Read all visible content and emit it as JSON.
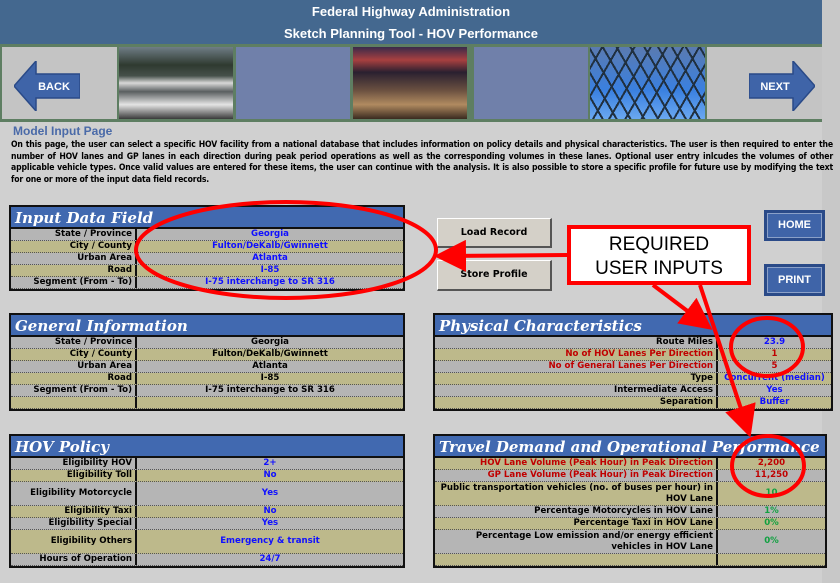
{
  "header": {
    "line1": "Federal Highway Administration",
    "line2": "Sketch Planning Tool - HOV Performance"
  },
  "nav": {
    "back_label": "BACK",
    "next_label": "NEXT",
    "nav_color": "#3f64a8"
  },
  "page": {
    "title": "Model Input Page",
    "intro": "On this page, the user can select a specific HOV facility from a national database that includes information on policy details and physical characteristics. The user is then required to enter the number of HOV lanes and GP lanes in each direction during peak period operations as well as the corresponding volumes in these lanes. Optional user entry inlcudes the volumes of other applicable vehicle types. Once valid values are entered for these items, the user can continue with the analysis. It is also possible to store a specific profile for future use by modifying the text for one or more of the input data field records."
  },
  "buttons": {
    "load": "Load Record",
    "store": "Store Profile",
    "home": "HOME",
    "print": "PRINT"
  },
  "annotation": {
    "callout_line1": "REQUIRED",
    "callout_line2": "USER INPUTS",
    "color": "#ff0000"
  },
  "input_data": {
    "title": "Input Data Field",
    "rows": [
      {
        "label": "State / Province",
        "value": "Georgia"
      },
      {
        "label": "City / County",
        "value": "Fulton/DeKalb/Gwinnett"
      },
      {
        "label": "Urban Area",
        "value": "Atlanta"
      },
      {
        "label": "Road",
        "value": "I-85"
      },
      {
        "label": "Segment (From - To)",
        "value": "I-75 interchange to SR 316"
      }
    ]
  },
  "general_info": {
    "title": "General Information",
    "rows": [
      {
        "label": "State / Province",
        "value": "Georgia"
      },
      {
        "label": "City / County",
        "value": "Fulton/DeKalb/Gwinnett"
      },
      {
        "label": "Urban Area",
        "value": "Atlanta"
      },
      {
        "label": "Road",
        "value": "I-85"
      },
      {
        "label": "Segment (From - To)",
        "value": "I-75 interchange to SR 316"
      },
      {
        "label": "",
        "value": ""
      }
    ]
  },
  "hov_policy": {
    "title": "HOV Policy",
    "rows": [
      {
        "label": "Eligibility HOV",
        "value": "2+"
      },
      {
        "label": "Eligibility Toll",
        "value": "No"
      },
      {
        "label": "Eligibility Motorcycle",
        "value": "Yes"
      },
      {
        "label": "Eligibility Taxi",
        "value": "No"
      },
      {
        "label": "Eligibility Special",
        "value": "Yes"
      },
      {
        "label": "Eligibility Others",
        "value": "Emergency & transit"
      },
      {
        "label": "Hours of Operation",
        "value": "24/7"
      }
    ]
  },
  "physical": {
    "title": "Physical Characteristics",
    "rows": [
      {
        "label": "Route Miles",
        "value": "23.9"
      },
      {
        "label": "No of HOV Lanes Per Direction",
        "value": "1"
      },
      {
        "label": "No of General Lanes Per Direction",
        "value": "5"
      },
      {
        "label": "Type",
        "value": "Concurrent (median)"
      },
      {
        "label": "Intermediate Access",
        "value": "Yes"
      },
      {
        "label": "Separation",
        "value": "Buffer"
      }
    ]
  },
  "travel": {
    "title": "Travel Demand and Operational Performance",
    "rows": [
      {
        "label": "HOV Lane Volume (Peak Hour) in Peak Direction",
        "value": "2,200"
      },
      {
        "label": "GP Lane Volume (Peak Hour) in Peak Direction",
        "value": "11,250"
      },
      {
        "label": "Public transportation vehicles (no. of buses per hour) in HOV Lane",
        "value": "10"
      },
      {
        "label": "Percentage Motorcycles in HOV Lane",
        "value": "1%"
      },
      {
        "label": "Percentage Taxi in HOV Lane",
        "value": "0%"
      },
      {
        "label": "Percentage Low emission and/or energy efficient vehicles in HOV Lane",
        "value": "0%"
      },
      {
        "label": "",
        "value": ""
      }
    ]
  }
}
